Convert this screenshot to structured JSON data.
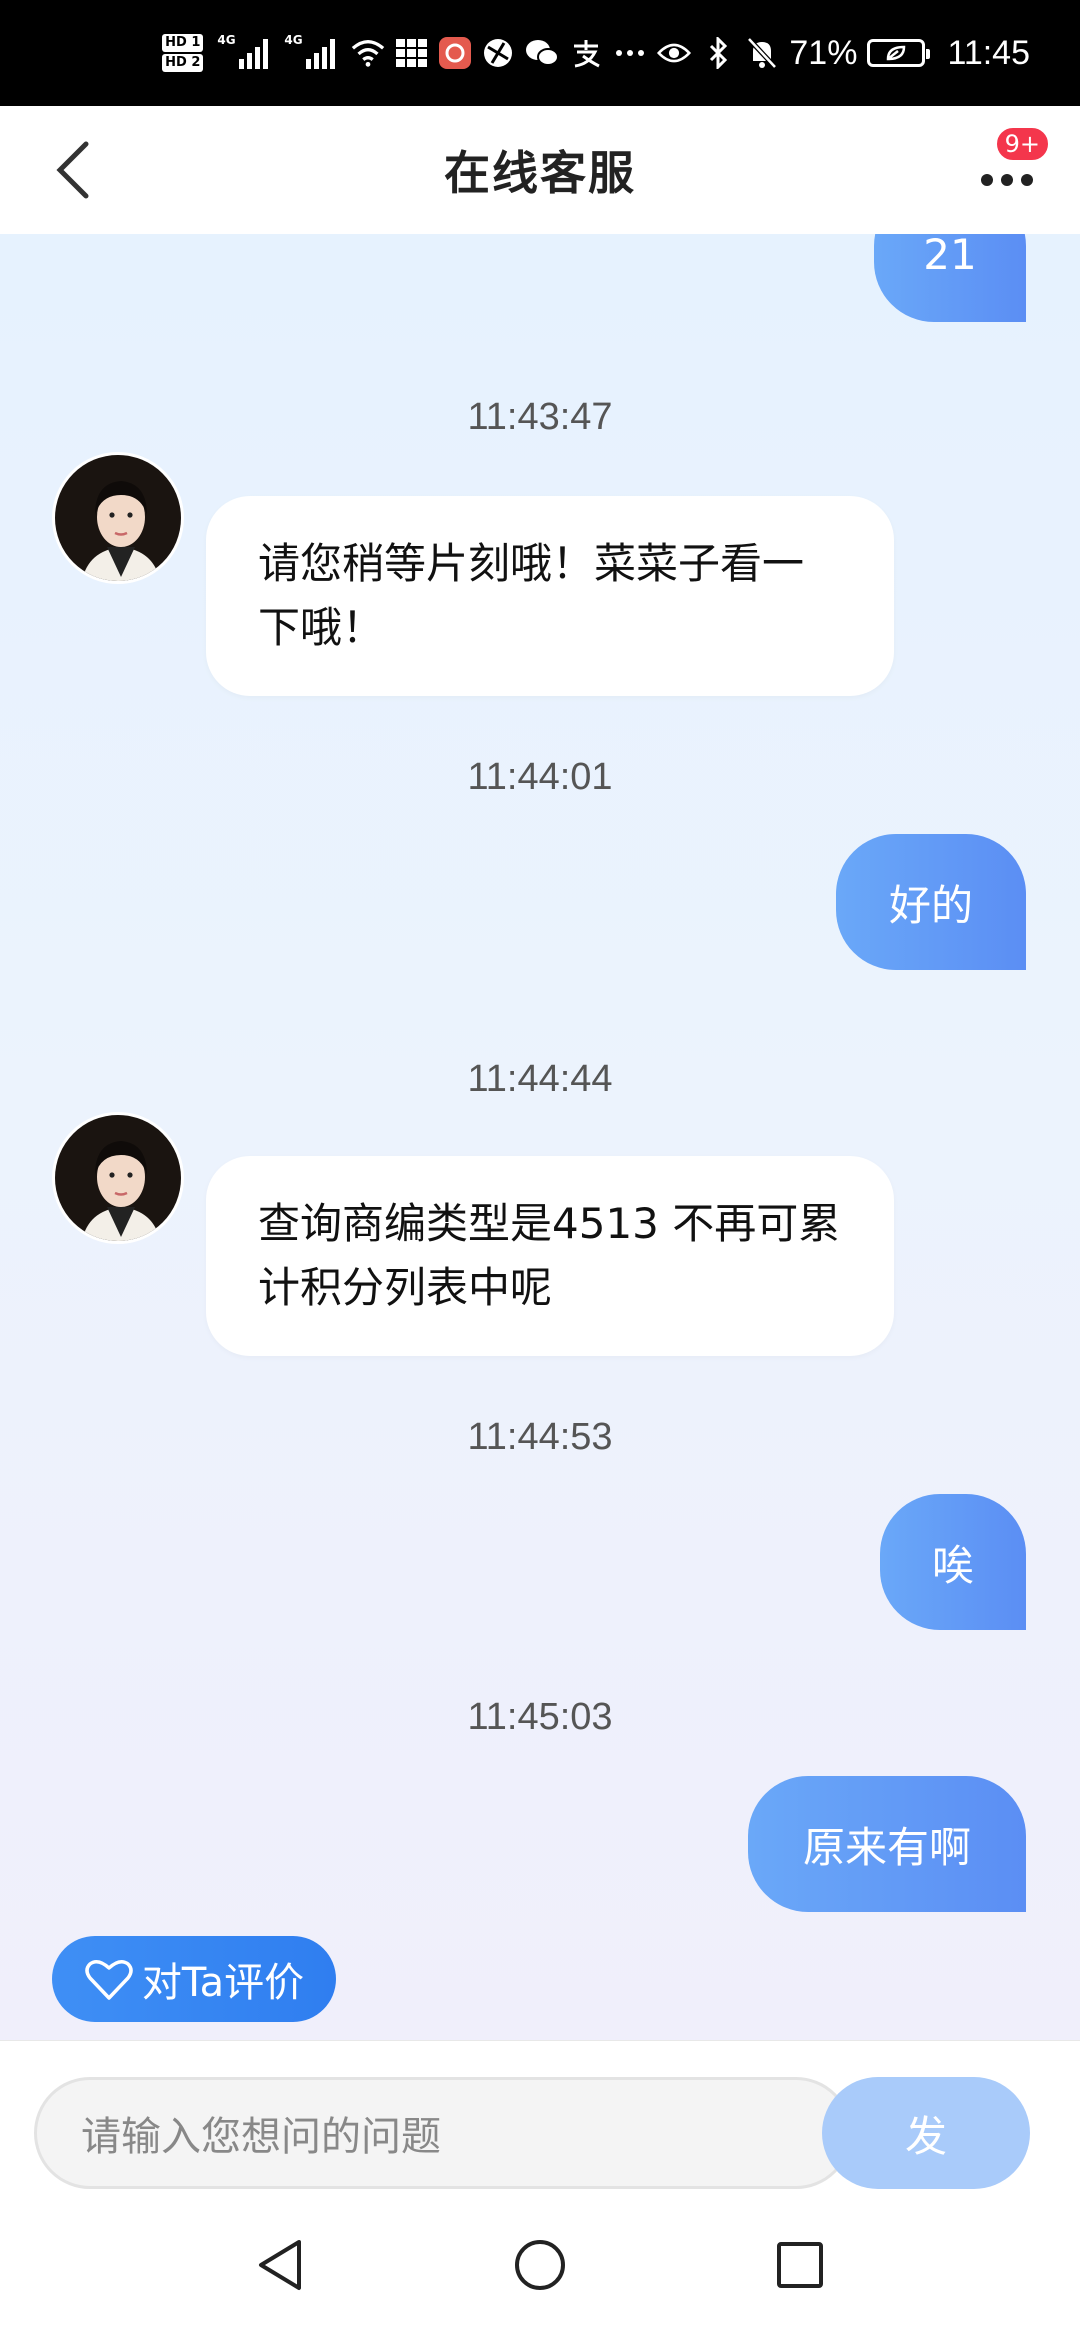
{
  "status_bar": {
    "hd1": "HD 1",
    "hd2": "HD 2",
    "network1": "4G",
    "network2": "4G",
    "battery_percent": "71%",
    "time": "11:45",
    "icons": [
      "signal-icon",
      "wifi-icon",
      "grid-app-icon",
      "app-notification-icon",
      "browser-icon",
      "wechat-icon",
      "alipay-icon",
      "more-dots-icon",
      "eye-icon",
      "bluetooth-icon",
      "mute-icon",
      "battery-icon"
    ]
  },
  "header": {
    "title": "在线客服",
    "badge": "9+"
  },
  "messages": [
    {
      "type": "out",
      "text": "21"
    },
    {
      "type": "time",
      "text": "11:43:47"
    },
    {
      "type": "in",
      "text": "请您稍等片刻哦！菜菜子看一下哦！"
    },
    {
      "type": "time",
      "text": "11:44:01"
    },
    {
      "type": "out",
      "text": "好的"
    },
    {
      "type": "time",
      "text": "11:44:44"
    },
    {
      "type": "in",
      "text": "查询商编类型是4513 不再可累计积分列表中呢"
    },
    {
      "type": "time",
      "text": "11:44:53"
    },
    {
      "type": "out",
      "text": "唉"
    },
    {
      "type": "time",
      "text": "11:45:03"
    },
    {
      "type": "out",
      "text": "原来有啊"
    }
  ],
  "rating_button": {
    "label": "对Ta评价"
  },
  "input": {
    "placeholder": "请输入您想问的问题"
  },
  "send_button": {
    "label": "发"
  },
  "colors": {
    "accent": "#5b8ef4",
    "send_disabled": "#a9cbfa",
    "badge": "#f4364c"
  }
}
